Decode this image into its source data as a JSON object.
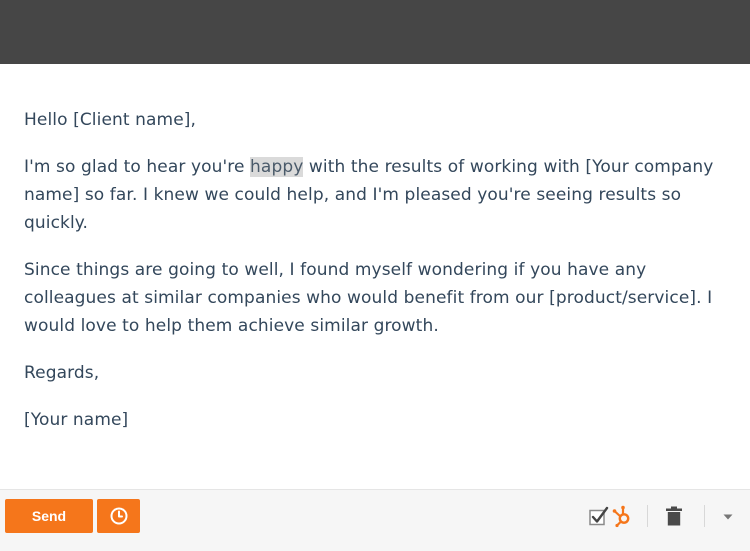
{
  "email": {
    "greeting": "Hello [Client name],",
    "paragraph1": {
      "before": "I'm so glad to hear you're ",
      "highlight": "happy",
      "after": " with the results of working with [Your company name] so far. I knew we could help, and I'm pleased you're seeing results so quickly."
    },
    "paragraph2": "Since things are going to well, I found myself wondering if you have any colleagues at similar companies who would benefit from our [product/service]. I would love to help them achieve similar growth.",
    "closing": "Regards,",
    "signature": "[Your name]"
  },
  "toolbar": {
    "send_label": "Send",
    "accent_color": "#f5761b",
    "icons": [
      "clock-icon",
      "checkbox-checked-icon",
      "hubspot-sprocket-icon",
      "trash-icon",
      "caret-down-icon"
    ]
  }
}
